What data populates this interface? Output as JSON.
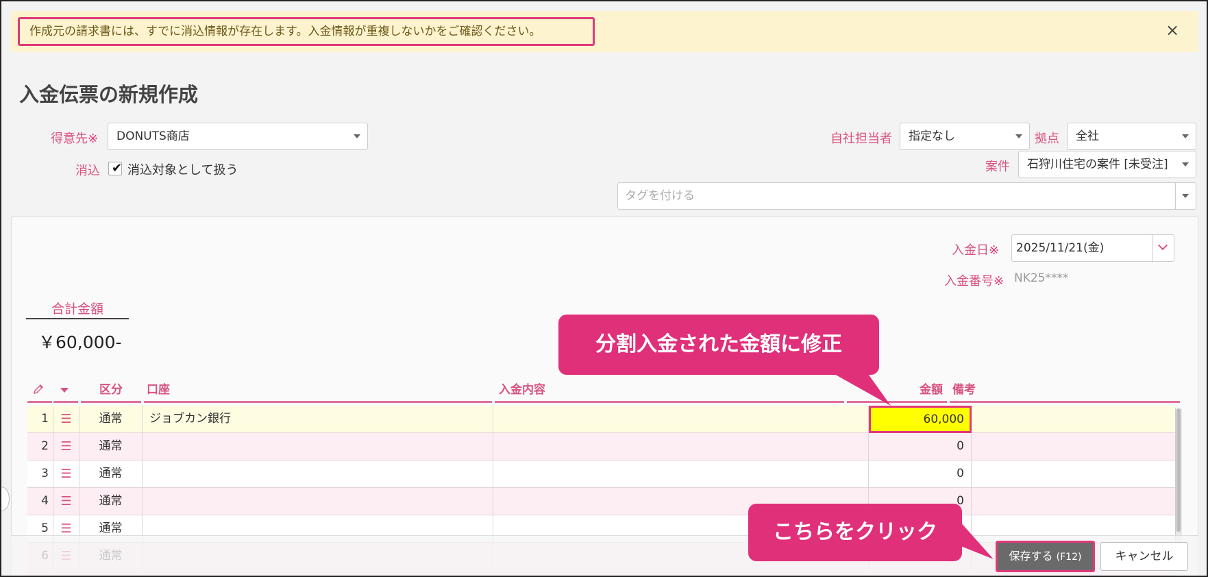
{
  "alert": {
    "message": "作成元の請求書には、すでに消込情報が存在します。入金情報が重複しないかをご確認ください。",
    "close": "×"
  },
  "page": {
    "title": "入金伝票の新規作成"
  },
  "form": {
    "customer_label": "得意先",
    "required_mark": "※",
    "customer_value": "DONUTS商店",
    "reconcile_label": "消込",
    "reconcile_checkbox_label": "消込対象として扱う",
    "check_mark": "✔",
    "staff_label": "自社担当者",
    "staff_value": "指定なし",
    "base_label": "拠点",
    "base_value": "全社",
    "project_label": "案件",
    "project_value": "石狩川住宅の案件 [未受注]",
    "tag_placeholder": "タグを付ける",
    "date_label": "入金日",
    "date_value": "2025/11/21(金)",
    "number_label": "入金番号",
    "number_value": "NK25****"
  },
  "total": {
    "label": "合計金額",
    "value": "￥60,000-"
  },
  "table": {
    "headers": {
      "kubun": "区分",
      "account": "口座",
      "content": "入金内容",
      "amount": "金額",
      "note": "備考"
    },
    "menu_glyph": "☰",
    "rows": [
      {
        "no": "1",
        "kubun": "通常",
        "account": "ジョブカン銀行",
        "content": "",
        "amount": "60,000",
        "note": ""
      },
      {
        "no": "2",
        "kubun": "通常",
        "account": "",
        "content": "",
        "amount": "0",
        "note": ""
      },
      {
        "no": "3",
        "kubun": "通常",
        "account": "",
        "content": "",
        "amount": "0",
        "note": ""
      },
      {
        "no": "4",
        "kubun": "通常",
        "account": "",
        "content": "",
        "amount": "0",
        "note": ""
      },
      {
        "no": "5",
        "kubun": "通常",
        "account": "",
        "content": "",
        "amount": "",
        "note": ""
      },
      {
        "no": "6",
        "kubun": "通常",
        "account": "",
        "content": "",
        "amount": "",
        "note": ""
      }
    ]
  },
  "buttons": {
    "save": "保存する",
    "save_shortcut": "(F12)",
    "cancel": "キャンセル"
  },
  "callouts": {
    "amount": "分割入金された金額に修正",
    "save": "こちらをクリック"
  },
  "colors": {
    "accent": "#e0307a",
    "label_pink": "#d9527f",
    "alert_bg": "#fdf3cf",
    "highlight_yellow": "#ffff00"
  }
}
